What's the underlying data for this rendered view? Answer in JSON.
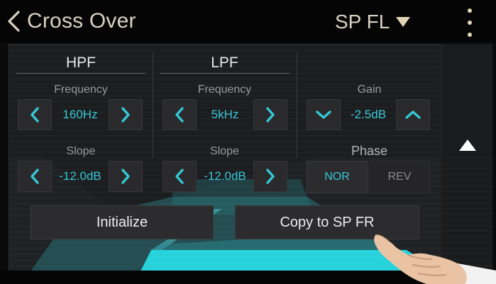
{
  "header": {
    "title": "Cross Over",
    "speaker": "SP FL"
  },
  "hpf": {
    "title": "HPF",
    "frequency_label": "Frequency",
    "frequency_value": "160Hz",
    "slope_label": "Slope",
    "slope_value": "-12.0dB"
  },
  "lpf": {
    "title": "LPF",
    "frequency_label": "Frequency",
    "frequency_value": "5kHz",
    "slope_label": "Slope",
    "slope_value": "-12.0dB"
  },
  "gain": {
    "label": "Gain",
    "value": "-2.5dB"
  },
  "phase": {
    "label": "Phase",
    "options": [
      "NOR",
      "REV"
    ],
    "selected": "NOR"
  },
  "actions": {
    "initialize": "Initialize",
    "copy": "Copy to SP FR"
  },
  "icons": {
    "back": "chevron-left-icon",
    "dropdown": "triangle-down-icon",
    "menu": "more-vertical-icon",
    "scroll": "triangle-up-icon"
  },
  "colors": {
    "accent": "#36c7d6",
    "text": "#d8d2c2",
    "curve": "#27d3dc"
  }
}
